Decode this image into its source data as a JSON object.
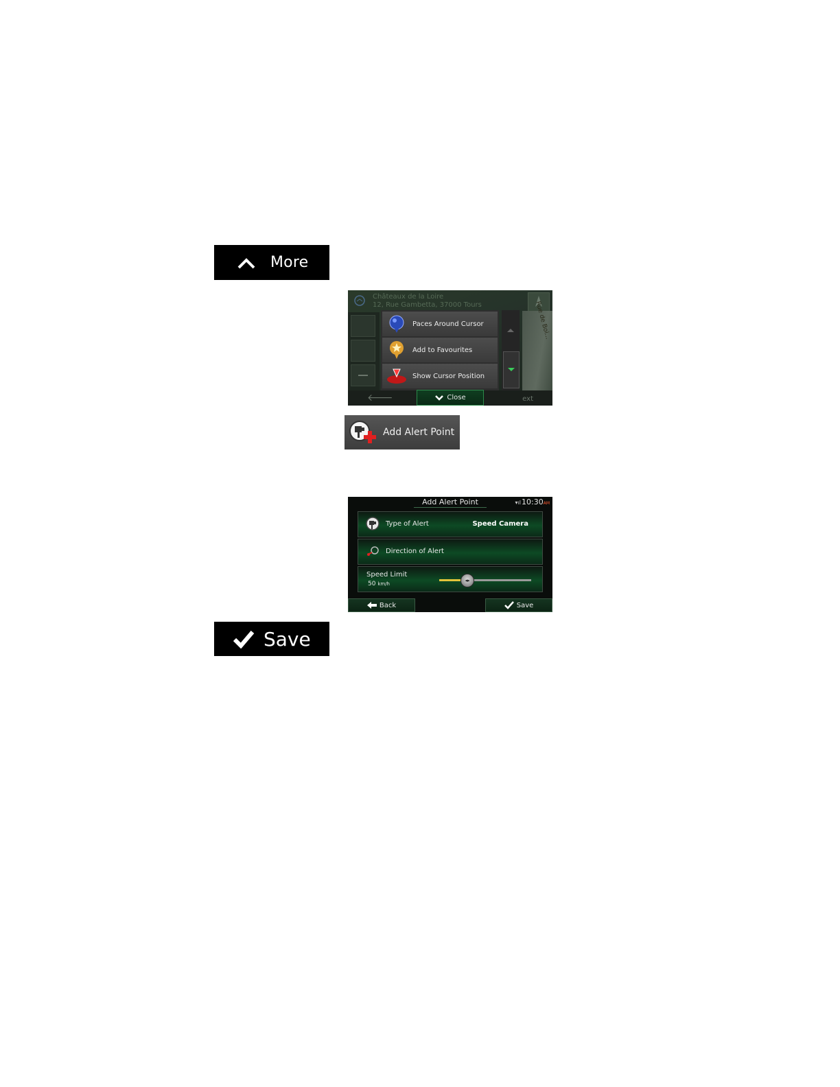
{
  "more_button": {
    "label": "More",
    "icon": "chevron-up-icon"
  },
  "map_screen": {
    "address_line1": "Châteaux de la Loire",
    "address_line2": "12, Rue Gambetta, 37000 Tours",
    "road_label": "Rue de Boi...",
    "menu": [
      {
        "label": "Paces Around Cursor",
        "icon": "blue-pin-icon"
      },
      {
        "label": "Add to Favourites",
        "icon": "favourite-star-pin-icon"
      },
      {
        "label": "Show Cursor Position",
        "icon": "cursor-position-icon"
      }
    ],
    "close_label": "Close",
    "next_label": "ext",
    "back_glyph": "🡐"
  },
  "alert_tile": {
    "label": "Add Alert Point",
    "icon": "speed-camera-add-icon"
  },
  "form_screen": {
    "title": "Add Alert Point",
    "clock": "10:30",
    "clock_ampm": "AM",
    "rows": {
      "type": {
        "label": "Type of Alert",
        "value": "Speed Camera"
      },
      "direction": {
        "label": "Direction of Alert"
      },
      "speed": {
        "label": "Speed Limit",
        "value": "50",
        "unit": "km/h",
        "slider_fraction": 0.3
      }
    },
    "back_label": "Back",
    "save_label": "Save"
  },
  "save_button": {
    "label": "Save",
    "icon": "checkmark-icon"
  },
  "colors": {
    "accent_green": "#0d4a24",
    "slider_fill": "#e3c43a",
    "alert_red": "#e02020"
  }
}
